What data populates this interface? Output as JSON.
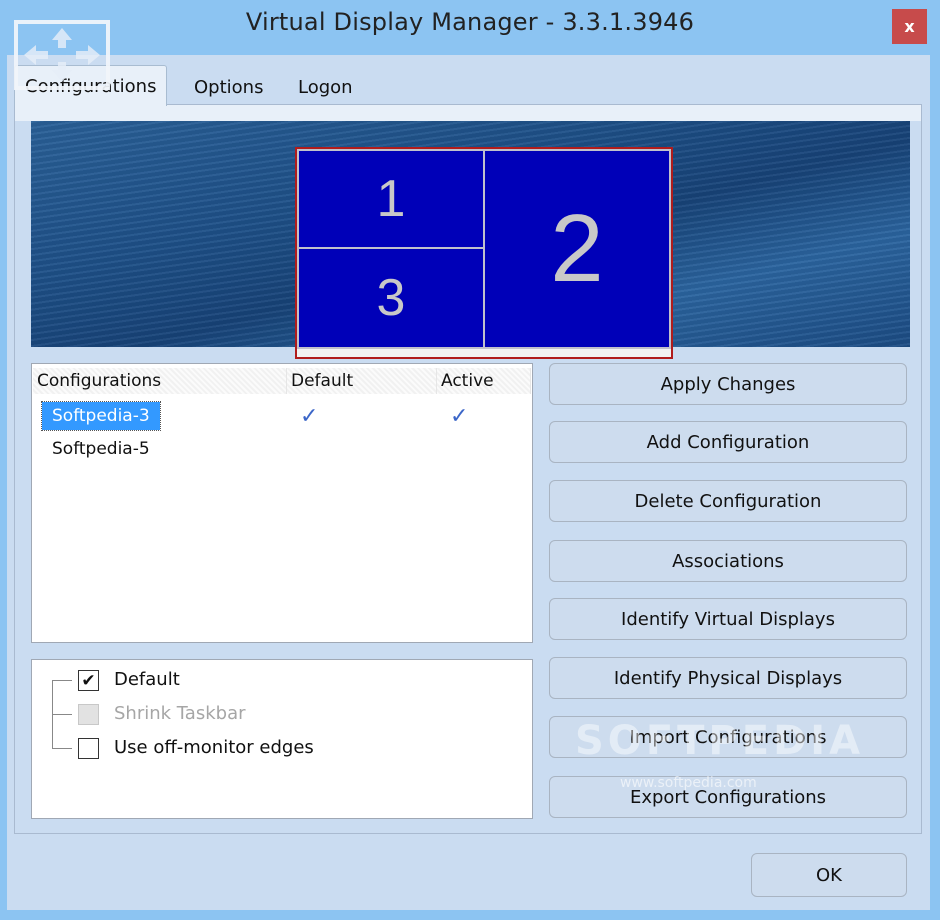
{
  "window": {
    "title": "Virtual Display Manager - 3.3.1.3946",
    "close_label": "x",
    "icon": "move-arrows-icon"
  },
  "tabs": [
    {
      "label": "Configurations",
      "active": true
    },
    {
      "label": "Options",
      "active": false
    },
    {
      "label": "Logon",
      "active": false
    }
  ],
  "layout_preview": {
    "displays": [
      {
        "id": "1",
        "label": "1"
      },
      {
        "id": "2",
        "label": "2"
      },
      {
        "id": "3",
        "label": "3"
      }
    ],
    "colors": {
      "display_fill": "#0000b8",
      "outline": "#b01c1c"
    }
  },
  "config_list": {
    "columns": [
      "Configurations",
      "Default",
      "Active"
    ],
    "rows": [
      {
        "name": "Softpedia-3",
        "default": true,
        "active": true,
        "selected": true
      },
      {
        "name": "Softpedia-5",
        "default": false,
        "active": false,
        "selected": false
      }
    ],
    "check_glyph": "✓"
  },
  "options": [
    {
      "label": "Default",
      "checked": true,
      "disabled": false
    },
    {
      "label": "Shrink Taskbar",
      "checked": false,
      "disabled": true
    },
    {
      "label": "Use off-monitor edges",
      "checked": false,
      "disabled": false
    }
  ],
  "buttons": {
    "apply": "Apply Changes",
    "add": "Add Configuration",
    "delete": "Delete Configuration",
    "associations": "Associations",
    "identify_virtual": "Identify Virtual Displays",
    "identify_physical": "Identify Physical Displays",
    "import": "Import Configurations",
    "export": "Export Configurations",
    "ok": "OK"
  },
  "watermark": {
    "brand": "SOFTPEDIA",
    "url": "www.softpedia.com"
  }
}
